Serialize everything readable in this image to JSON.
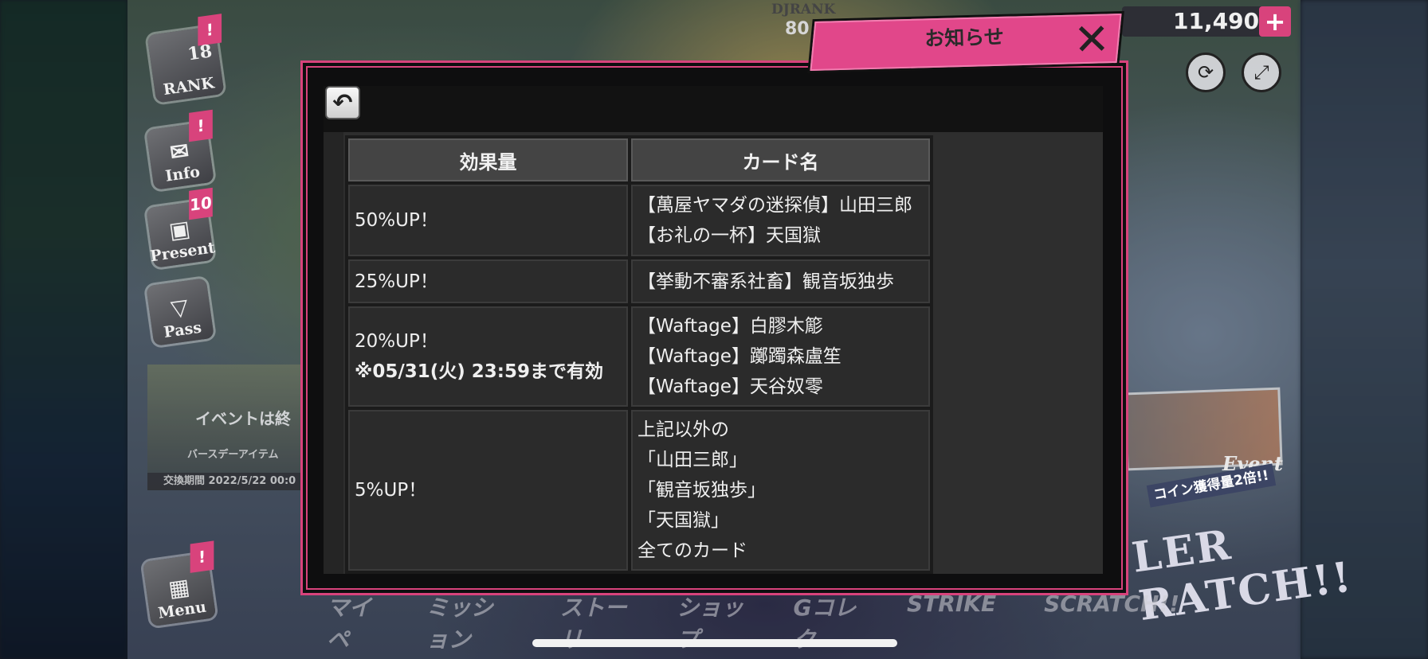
{
  "hud": {
    "rank_label": "RANK",
    "rank_value": "18",
    "info_label": "Info",
    "present_label": "Present",
    "present_badge": "10",
    "pass_label": "Pass",
    "menu_label": "Menu",
    "alert_badge": "!",
    "dj_rank_label": "DJRANK",
    "dj_rank_value": "80",
    "coins": "11,490",
    "coin_add": "+"
  },
  "background": {
    "event_title": "イベントは終",
    "event_sub": "バースデーアイテム",
    "event_period": "交換期間 2022/5/22 00:0",
    "right_event_label": "Event",
    "right_event_coin": "コイン獲得量2倍!!",
    "right_event_logo": "LER RATCH!!",
    "bottom_nav": [
      "マイペ",
      "ミッション",
      "ストーリ",
      "ショップ",
      "Gコレク",
      "STRIKE",
      "SCRATCH!!"
    ]
  },
  "modal": {
    "title": "お知らせ",
    "close_icon": "close-icon",
    "back_icon": "back-arrow-icon",
    "table": {
      "headers": [
        "効果量",
        "カード名"
      ],
      "rows": [
        {
          "effect": "50%UP！",
          "note": "",
          "cards": [
            "【萬屋ヤマダの迷探偵】山田三郎",
            "【お礼の一杯】天国獄"
          ]
        },
        {
          "effect": "25%UP！",
          "note": "",
          "cards": [
            "【挙動不審系社畜】観音坂独歩"
          ]
        },
        {
          "effect": "20%UP！",
          "note": "※05/31(火) 23:59まで有効",
          "cards": [
            "【Waftage】白膠木簓",
            "【Waftage】躑躅森盧笙",
            "【Waftage】天谷奴零"
          ]
        },
        {
          "effect": "5%UP！",
          "note": "",
          "cards": [
            "上記以外の",
            "「山田三郎」",
            "「観音坂独歩」",
            "「天国獄」",
            "全てのカード"
          ]
        }
      ]
    }
  },
  "colors": {
    "accent": "#d8437c",
    "modal_bg": "#0e0e0f",
    "table_header": "#444444",
    "table_cell": "#2b2b2b"
  }
}
